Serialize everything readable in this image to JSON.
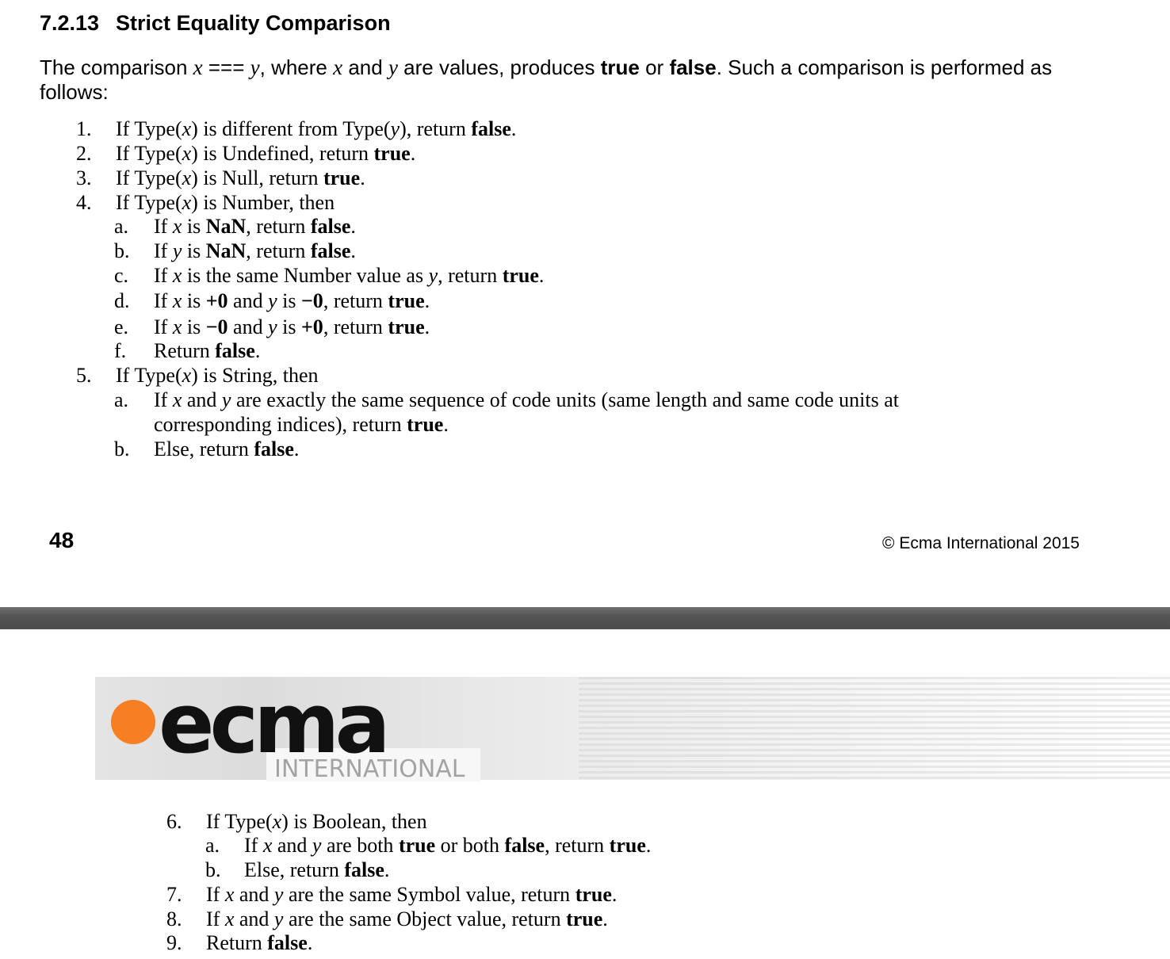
{
  "page1": {
    "heading_number": "7.2.13",
    "heading_title": "Strict Equality Comparison",
    "intro": {
      "t1": "The comparison ",
      "x": "x",
      "op": " === ",
      "y": "y",
      "t2": ", where ",
      "x2": "x",
      "t3": " and ",
      "y2": "y",
      "t4": " are values, produces ",
      "b_true": "true",
      "t5": " or ",
      "b_false": "false",
      "t6": ". Such a comparison is performed as follows:"
    },
    "steps": [
      {
        "label": "1.",
        "parts": [
          {
            "t": "If Type("
          },
          {
            "i": "x"
          },
          {
            "t": ") is different from Type("
          },
          {
            "i": "y"
          },
          {
            "t": "), return "
          },
          {
            "b": "false"
          },
          {
            "t": "."
          }
        ]
      },
      {
        "label": "2.",
        "parts": [
          {
            "t": "If Type("
          },
          {
            "i": "x"
          },
          {
            "t": ") is Undefined, return "
          },
          {
            "b": "true"
          },
          {
            "t": "."
          }
        ]
      },
      {
        "label": "3.",
        "parts": [
          {
            "t": "If Type("
          },
          {
            "i": "x"
          },
          {
            "t": ") is Null, return "
          },
          {
            "b": "true"
          },
          {
            "t": "."
          }
        ]
      },
      {
        "label": "4.",
        "parts": [
          {
            "t": "If Type("
          },
          {
            "i": "x"
          },
          {
            "t": ") is Number, then"
          }
        ]
      },
      {
        "label": "a.",
        "sub": true,
        "parts": [
          {
            "t": "If "
          },
          {
            "i": "x"
          },
          {
            "t": " is "
          },
          {
            "b": "NaN"
          },
          {
            "t": ", return "
          },
          {
            "b": "false"
          },
          {
            "t": "."
          }
        ]
      },
      {
        "label": "b.",
        "sub": true,
        "parts": [
          {
            "t": "If "
          },
          {
            "i": "y"
          },
          {
            "t": " is "
          },
          {
            "b": "NaN"
          },
          {
            "t": ", return "
          },
          {
            "b": "false"
          },
          {
            "t": "."
          }
        ]
      },
      {
        "label": "c.",
        "sub": true,
        "parts": [
          {
            "t": "If "
          },
          {
            "i": "x"
          },
          {
            "t": " is the same Number value as "
          },
          {
            "i": "y"
          },
          {
            "t": ", return "
          },
          {
            "b": "true"
          },
          {
            "t": "."
          }
        ]
      },
      {
        "label": "d.",
        "sub": true,
        "parts": [
          {
            "t": "If "
          },
          {
            "i": "x"
          },
          {
            "t": " is "
          },
          {
            "b": "+0"
          },
          {
            "t": " and "
          },
          {
            "i": "y"
          },
          {
            "t": " is "
          },
          {
            "b": "−0"
          },
          {
            "t": ", return "
          },
          {
            "b": "true"
          },
          {
            "t": "."
          }
        ]
      },
      {
        "label": "e.",
        "sub": true,
        "parts": [
          {
            "t": "If "
          },
          {
            "i": "x"
          },
          {
            "t": " is "
          },
          {
            "b": "−0"
          },
          {
            "t": " and "
          },
          {
            "i": "y"
          },
          {
            "t": " is "
          },
          {
            "b": "+0"
          },
          {
            "t": ", return "
          },
          {
            "b": "true"
          },
          {
            "t": "."
          }
        ]
      },
      {
        "label": "f.",
        "sub": true,
        "parts": [
          {
            "t": "Return "
          },
          {
            "b": "false"
          },
          {
            "t": "."
          }
        ]
      },
      {
        "label": "5.",
        "parts": [
          {
            "t": "If Type("
          },
          {
            "i": "x"
          },
          {
            "t": ") is String, then"
          }
        ]
      },
      {
        "label": "a.",
        "sub": true,
        "parts": [
          {
            "t": "If "
          },
          {
            "i": "x"
          },
          {
            "t": " and "
          },
          {
            "i": "y"
          },
          {
            "t": " are exactly the same sequence of code units (same length and same code units at"
          }
        ]
      },
      {
        "label": "",
        "sub": true,
        "parts": [
          {
            "t": "corresponding indices), return "
          },
          {
            "b": "true"
          },
          {
            "t": "."
          }
        ]
      },
      {
        "label": "b.",
        "sub": true,
        "parts": [
          {
            "t": "Else, return "
          },
          {
            "b": "false"
          },
          {
            "t": "."
          }
        ]
      }
    ],
    "page_number": "48",
    "copyright": "© Ecma International 2015"
  },
  "page2": {
    "logo_word": "ecma",
    "logo_sub": "INTERNATIONAL",
    "logo_dot_color": "#f57f22",
    "steps": [
      {
        "label": "6.",
        "parts": [
          {
            "t": "If Type("
          },
          {
            "i": "x"
          },
          {
            "t": ") is Boolean, then"
          }
        ]
      },
      {
        "label": "a.",
        "sub": true,
        "parts": [
          {
            "t": "If "
          },
          {
            "i": "x"
          },
          {
            "t": " and "
          },
          {
            "i": "y"
          },
          {
            "t": " are both "
          },
          {
            "b": "true"
          },
          {
            "t": " or both "
          },
          {
            "b": "false"
          },
          {
            "t": ", return "
          },
          {
            "b": "true"
          },
          {
            "t": "."
          }
        ]
      },
      {
        "label": "b.",
        "sub": true,
        "parts": [
          {
            "t": "Else, return "
          },
          {
            "b": "false"
          },
          {
            "t": "."
          }
        ]
      },
      {
        "label": "7.",
        "parts": [
          {
            "t": "If "
          },
          {
            "i": "x"
          },
          {
            "t": " and "
          },
          {
            "i": "y"
          },
          {
            "t": " are the same Symbol value, return "
          },
          {
            "b": "true"
          },
          {
            "t": "."
          }
        ]
      },
      {
        "label": "8.",
        "parts": [
          {
            "t": "If "
          },
          {
            "i": "x"
          },
          {
            "t": " and "
          },
          {
            "i": "y"
          },
          {
            "t": " are the same Object value, return "
          },
          {
            "b": "true"
          },
          {
            "t": "."
          }
        ]
      },
      {
        "label": "9.",
        "parts": [
          {
            "t": "Return "
          },
          {
            "b": "false"
          },
          {
            "t": "."
          }
        ]
      }
    ]
  }
}
